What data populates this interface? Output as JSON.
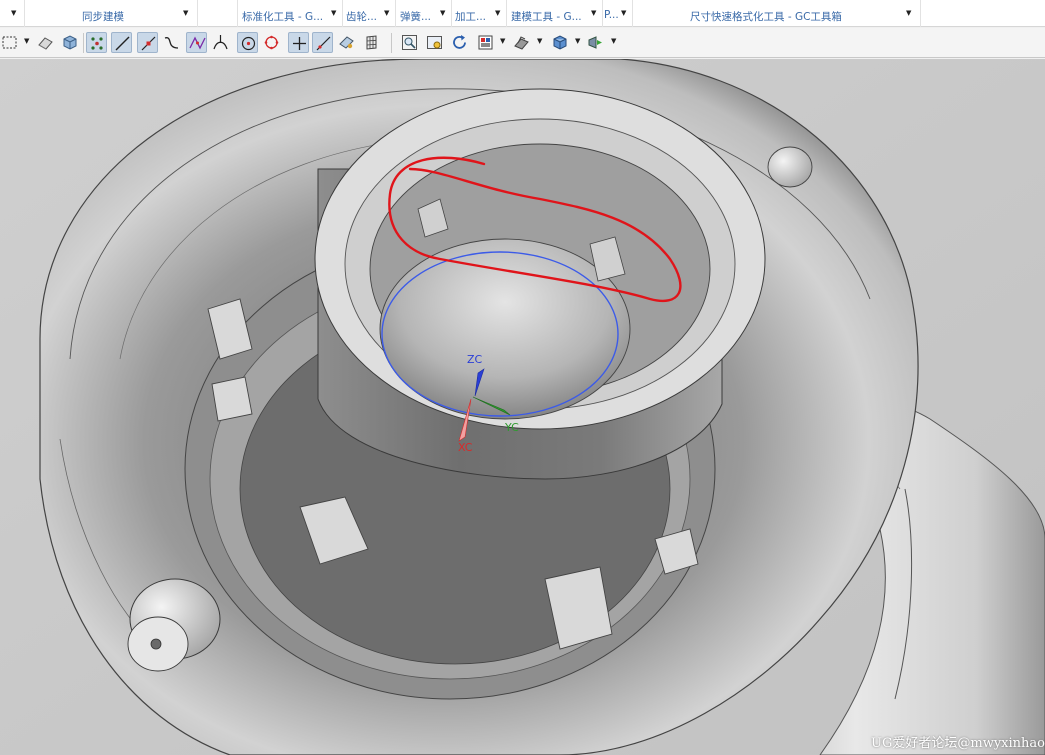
{
  "ribbon_groups": [
    {
      "label": ""
    },
    {
      "label": "同步建模"
    },
    {
      "label": ""
    },
    {
      "label": "标准化工具 - G..."
    },
    {
      "label": "齿轮..."
    },
    {
      "label": "弹簧..."
    },
    {
      "label": "加工..."
    },
    {
      "label": "建模工具 - G..."
    },
    {
      "label": "P..."
    },
    {
      "label": "尺寸快速格式化工具 - GC工具箱"
    }
  ],
  "toolbar": {
    "icons": [
      "select-box-icon",
      "eraser-icon",
      "cube-view-icon",
      "snap-points-icon",
      "line-snap-icon",
      "end-point-icon",
      "curve-icon",
      "intersection-icon",
      "tangent-icon",
      "circle-center-icon",
      "quadrant-icon",
      "crosshair-icon",
      "edge-icon",
      "face-analysis-icon",
      "grid-icon",
      "zoom-fit-icon",
      "zoom-window-icon",
      "rotate-icon",
      "layout-icon",
      "render-style-icon",
      "shaded-cube-icon",
      "view-orient-icon"
    ]
  },
  "viewport": {
    "axes": {
      "z": "ZC",
      "y": "YC",
      "x": "XC"
    },
    "colors": {
      "z": "#2b3fd6",
      "y": "#2f9a2f",
      "x": "#d62b2b",
      "annotation": "#e0141a"
    },
    "watermark": "UG爱好者论坛@mwyxinhao"
  }
}
